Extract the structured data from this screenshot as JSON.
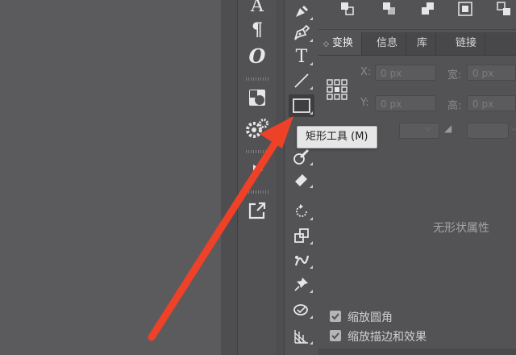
{
  "colors": {
    "annotation_arrow": "#ee4128",
    "tooltip_bg": "#e6e6e6",
    "panel_bg": "#535355"
  },
  "char_panel": {
    "icons": [
      "character-icon",
      "paragraph-icon",
      "opentype-icon",
      "appearance-icon",
      "settings-gear-icon",
      "play-icon",
      "export-icon"
    ],
    "glyphs": {
      "paragraph": "¶",
      "opentype": "O",
      "character": "A"
    }
  },
  "toolbar": {
    "tools": [
      "curvature-pen-tool",
      "pen-tool",
      "type-tool",
      "line-segment-tool",
      "rectangle-tool",
      "shaper-tool",
      "pencil-tool",
      "eraser-tool",
      "rotate-tool",
      "scale-tool",
      "puppet-warp-tool",
      "pin-tool",
      "shape-builder-tool",
      "perspective-grid-tool"
    ],
    "type_glyph": "T",
    "active_tool": "rectangle-tool",
    "tooltip": "矩形工具 (M)"
  },
  "panel": {
    "tabs": [
      {
        "label": "变换",
        "active": true
      },
      {
        "label": "信息",
        "active": false
      },
      {
        "label": "库",
        "active": false
      },
      {
        "label": "链接",
        "active": false
      }
    ],
    "fields": {
      "x_label": "X:",
      "y_label": "Y:",
      "w_label": "宽:",
      "h_label": "高:",
      "x_value": "0 px",
      "y_value": "0 px",
      "w_value": "0 px",
      "h_value": "0 px"
    },
    "no_shape_text": "无形状属性",
    "checkboxes": [
      {
        "label": "缩放圆角",
        "checked": true
      },
      {
        "label": "缩放描边和效果",
        "checked": true
      }
    ]
  }
}
